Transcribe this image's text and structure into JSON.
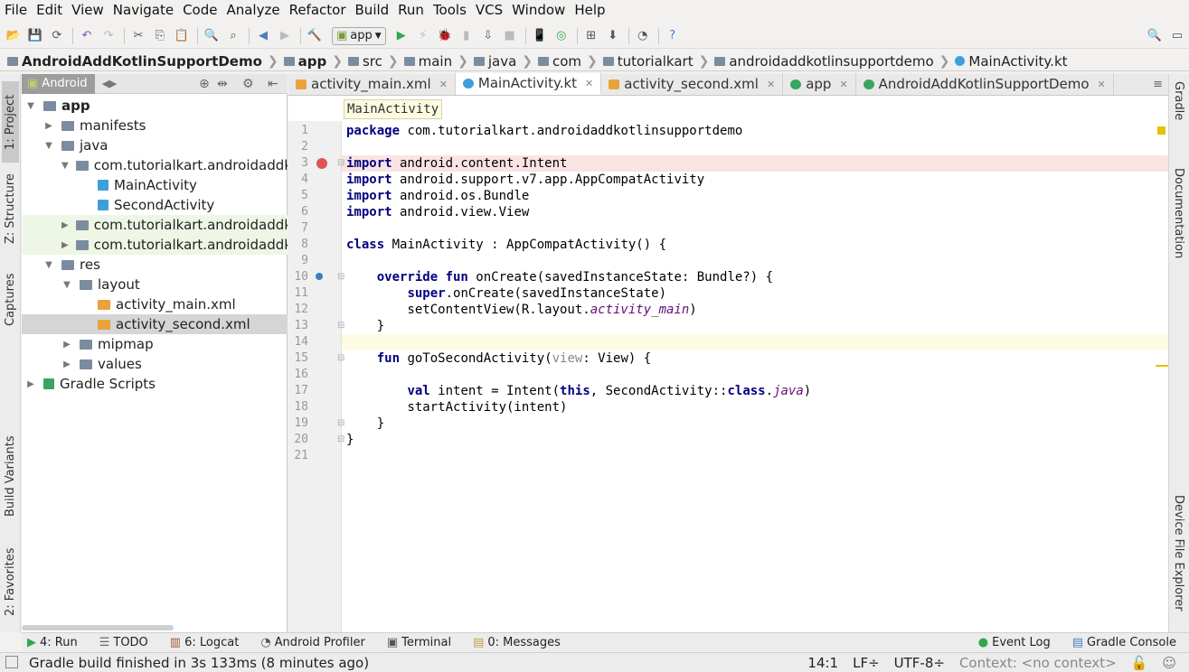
{
  "menu": [
    "File",
    "Edit",
    "View",
    "Navigate",
    "Code",
    "Analyze",
    "Refactor",
    "Build",
    "Run",
    "Tools",
    "VCS",
    "Window",
    "Help"
  ],
  "toolbar": {
    "run_config": "app"
  },
  "breadcrumb": [
    "AndroidAddKotlinSupportDemo",
    "app",
    "src",
    "main",
    "java",
    "com",
    "tutorialkart",
    "androidaddkotlinsupportdemo",
    "MainActivity.kt"
  ],
  "left_tabs": [
    "1: Project",
    "Z: Structure",
    "Captures",
    "Build Variants",
    "2: Favorites"
  ],
  "right_tabs": [
    "Gradle",
    "Documentation",
    "Device File Explorer"
  ],
  "project": {
    "selector": "Android",
    "tree": [
      {
        "label": "app",
        "depth": 0,
        "arrow": "▼",
        "icon": "folder",
        "bold": true
      },
      {
        "label": "manifests",
        "depth": 1,
        "arrow": "▶",
        "icon": "folder"
      },
      {
        "label": "java",
        "depth": 1,
        "arrow": "▼",
        "icon": "folder"
      },
      {
        "label": "com.tutorialkart.androidaddkotlinsupportdemo",
        "depth": 2,
        "arrow": "▼",
        "icon": "folder"
      },
      {
        "label": "MainActivity",
        "depth": 3,
        "arrow": "",
        "icon": "kt"
      },
      {
        "label": "SecondActivity",
        "depth": 3,
        "arrow": "",
        "icon": "kt"
      },
      {
        "label": "com.tutorialkart.androidaddkotlinsupportdemo (androidTest)",
        "depth": 2,
        "arrow": "▶",
        "icon": "folder",
        "hl": true
      },
      {
        "label": "com.tutorialkart.androidaddkotlinsupportdemo (test)",
        "depth": 2,
        "arrow": "▶",
        "icon": "folder",
        "hl": true
      },
      {
        "label": "res",
        "depth": 1,
        "arrow": "▼",
        "icon": "folder"
      },
      {
        "label": "layout",
        "depth": 2,
        "arrow": "▼",
        "icon": "folder"
      },
      {
        "label": "activity_main.xml",
        "depth": 3,
        "arrow": "",
        "icon": "xml"
      },
      {
        "label": "activity_second.xml",
        "depth": 3,
        "arrow": "",
        "icon": "xml",
        "selected": true
      },
      {
        "label": "mipmap",
        "depth": 2,
        "arrow": "▶",
        "icon": "folder"
      },
      {
        "label": "values",
        "depth": 2,
        "arrow": "▶",
        "icon": "folder"
      },
      {
        "label": "Gradle Scripts",
        "depth": 0,
        "arrow": "▶",
        "icon": "gradle"
      }
    ]
  },
  "tabs": [
    {
      "label": "activity_main.xml",
      "icon": "xml"
    },
    {
      "label": "MainActivity.kt",
      "icon": "kt",
      "active": true
    },
    {
      "label": "activity_second.xml",
      "icon": "xml"
    },
    {
      "label": "app",
      "icon": "gradle"
    },
    {
      "label": "AndroidAddKotlinSupportDemo",
      "icon": "gradle"
    }
  ],
  "editor": {
    "breadcrumb_hint": "MainActivity",
    "lines": [
      [
        [
          "kw",
          "package"
        ],
        [
          "",
          " com.tutorialkart.androidaddkotlinsupportdemo"
        ]
      ],
      [],
      [
        [
          "kw",
          "import"
        ],
        [
          "",
          " android.content.Intent"
        ]
      ],
      [
        [
          "kw",
          "import"
        ],
        [
          "",
          " android.support.v7.app.AppCompatActivity"
        ]
      ],
      [
        [
          "kw",
          "import"
        ],
        [
          "",
          " android.os.Bundle"
        ]
      ],
      [
        [
          "kw",
          "import"
        ],
        [
          "",
          " android.view.View"
        ]
      ],
      [],
      [
        [
          "kw",
          "class"
        ],
        [
          "",
          " MainActivity : AppCompatActivity() {"
        ]
      ],
      [],
      [
        [
          "",
          "    "
        ],
        [
          "kw",
          "override fun"
        ],
        [
          "",
          " onCreate(savedInstanceState: Bundle?) {"
        ]
      ],
      [
        [
          "",
          "        "
        ],
        [
          "kw",
          "super"
        ],
        [
          "",
          ".onCreate(savedInstanceState)"
        ]
      ],
      [
        [
          "",
          "        setContentView(R.layout."
        ],
        [
          "it",
          "activity_main"
        ],
        [
          "",
          ")"
        ]
      ],
      [
        [
          "",
          "    }"
        ]
      ],
      [],
      [
        [
          "",
          "    "
        ],
        [
          "kw",
          "fun"
        ],
        [
          "",
          " goToSecondActivity("
        ],
        [
          "hint",
          "view"
        ],
        [
          "",
          ": View) {"
        ]
      ],
      [],
      [
        [
          "",
          "        "
        ],
        [
          "kw",
          "val"
        ],
        [
          "",
          " intent = Intent("
        ],
        [
          "kw",
          "this"
        ],
        [
          "",
          ", SecondActivity::"
        ],
        [
          "kw",
          "class"
        ],
        [
          "",
          "."
        ],
        [
          "it",
          "java"
        ],
        [
          "",
          ")"
        ]
      ],
      [
        [
          "",
          "        startActivity(intent)"
        ]
      ],
      [
        [
          "",
          "    }"
        ]
      ],
      [
        [
          "",
          "}"
        ]
      ],
      []
    ]
  },
  "bottom_tools": [
    "4: Run",
    "TODO",
    "6: Logcat",
    "Android Profiler",
    "Terminal",
    "0: Messages"
  ],
  "bottom_right_tools": [
    "Event Log",
    "Gradle Console"
  ],
  "status": {
    "message": "Gradle build finished in 3s 133ms (8 minutes ago)",
    "position": "14:1",
    "line_sep": "LF÷",
    "encoding": "UTF-8÷",
    "context": "Context: <no context>"
  }
}
